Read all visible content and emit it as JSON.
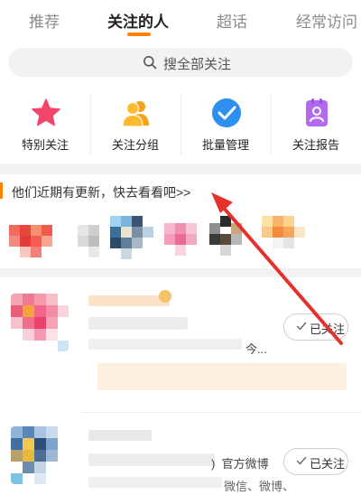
{
  "tabs": [
    {
      "label": "推荐",
      "active": false
    },
    {
      "label": "关注的人",
      "active": true
    },
    {
      "label": "超话",
      "active": false
    },
    {
      "label": "经常访问",
      "active": false
    }
  ],
  "search": {
    "placeholder": "搜全部关注",
    "icon": "search-icon"
  },
  "quick_actions": [
    {
      "label": "特别关注",
      "icon": "star-icon"
    },
    {
      "label": "关注分组",
      "icon": "people-group-icon"
    },
    {
      "label": "批量管理",
      "icon": "check-circle-icon"
    },
    {
      "label": "关注报告",
      "icon": "report-icon"
    }
  ],
  "update_banner": {
    "text": "他们近期有更新，快去看看吧>>"
  },
  "follow_list": [
    {
      "snippet": "今...",
      "button": "已关注"
    },
    {
      "tag": "官方微博",
      "snippet": "微信、微博、",
      "button": "已关注"
    }
  ],
  "colors": {
    "accent": "#ff8200",
    "annotation_arrow": "#e5322d",
    "band": "#f2f2f2"
  }
}
